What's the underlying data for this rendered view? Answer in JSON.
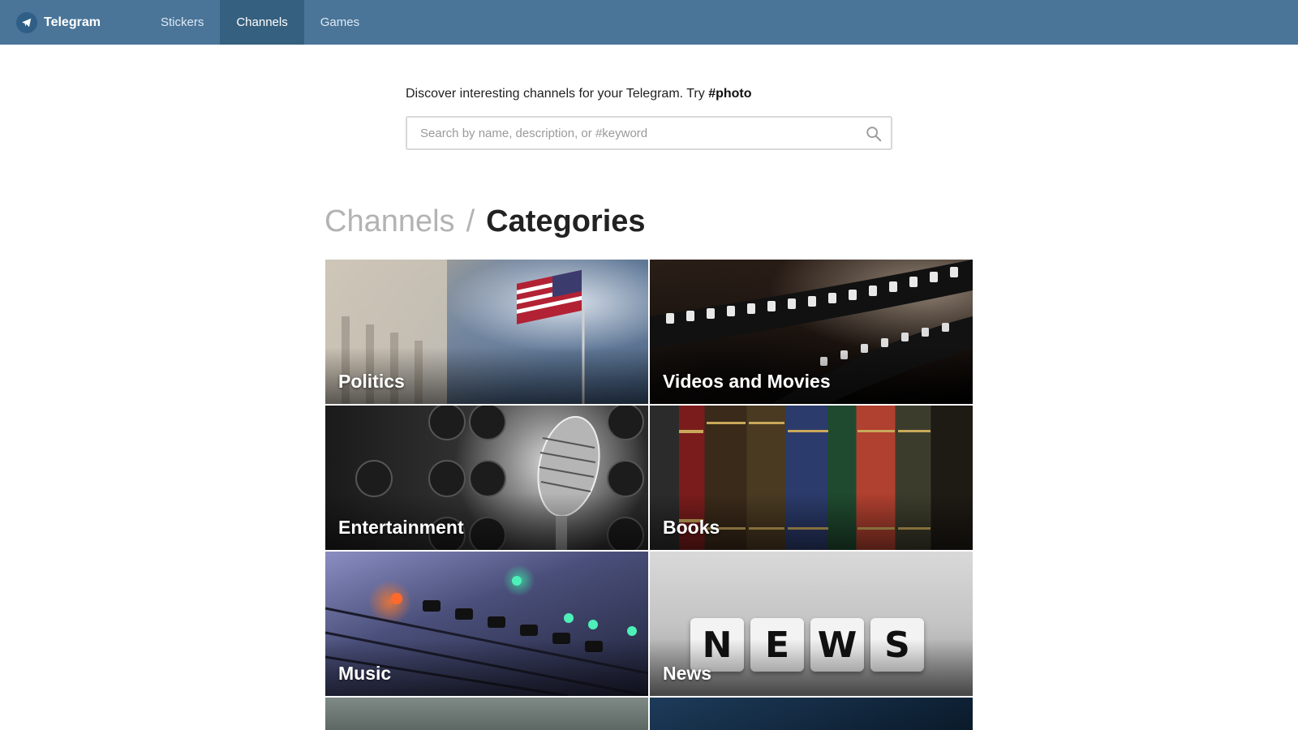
{
  "header": {
    "brand": "Telegram",
    "nav": [
      {
        "label": "Stickers",
        "active": false
      },
      {
        "label": "Channels",
        "active": true
      },
      {
        "label": "Games",
        "active": false
      }
    ],
    "bar_color": "#4a7599"
  },
  "search": {
    "intro_text": "Discover interesting channels for your Telegram. Try ",
    "intro_tag": "#photo",
    "placeholder": "Search by name, description, or #keyword"
  },
  "breadcrumb": {
    "parent": "Channels",
    "separator": "/",
    "current": "Categories"
  },
  "categories": [
    {
      "label": "Politics"
    },
    {
      "label": "Videos and Movies"
    },
    {
      "label": "Entertainment"
    },
    {
      "label": "Books"
    },
    {
      "label": "Music"
    },
    {
      "label": "News"
    }
  ],
  "news_letters": [
    "N",
    "E",
    "W",
    "S"
  ]
}
